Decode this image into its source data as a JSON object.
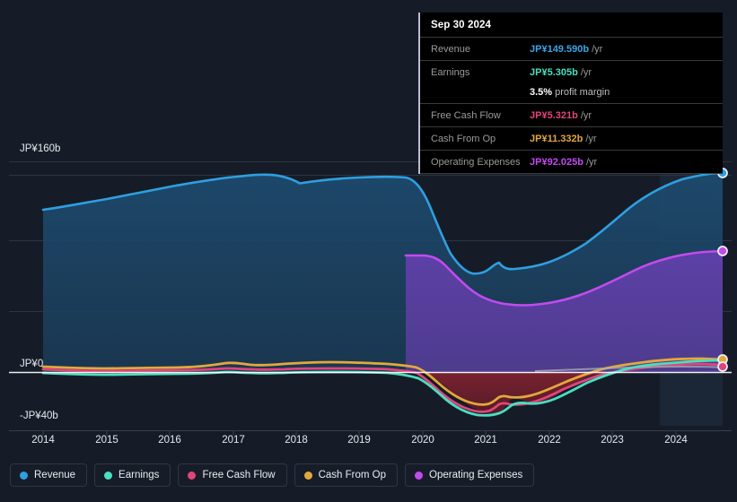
{
  "tooltip": {
    "title": "Sep 30 2024",
    "rows": [
      {
        "label": "Revenue",
        "value": "JP¥149.590b",
        "unit": "/yr",
        "color": "#3aa5e8"
      },
      {
        "label": "Earnings",
        "value": "JP¥5.305b",
        "unit": "/yr",
        "color": "#49dfc0"
      },
      {
        "label": "",
        "value": "3.5%",
        "unit": "profit margin",
        "color": "#ffffff",
        "sub": true
      },
      {
        "label": "Free Cash Flow",
        "value": "JP¥5.321b",
        "unit": "/yr",
        "color": "#e0457b"
      },
      {
        "label": "Cash From Op",
        "value": "JP¥11.332b",
        "unit": "/yr",
        "color": "#e3a83c"
      },
      {
        "label": "Operating Expenses",
        "value": "JP¥92.025b",
        "unit": "/yr",
        "color": "#c34aee"
      }
    ]
  },
  "axes": {
    "y_labels": [
      "JP¥160b",
      "JP¥0",
      "-JP¥40b"
    ],
    "x_labels": [
      "2014",
      "2015",
      "2016",
      "2017",
      "2018",
      "2019",
      "2020",
      "2021",
      "2022",
      "2023",
      "2024"
    ]
  },
  "legend": [
    {
      "label": "Revenue",
      "color": "#2f9fe0"
    },
    {
      "label": "Earnings",
      "color": "#49dfc0"
    },
    {
      "label": "Free Cash Flow",
      "color": "#e0457b"
    },
    {
      "label": "Cash From Op",
      "color": "#e3a83c"
    },
    {
      "label": "Operating Expenses",
      "color": "#c34aee"
    }
  ],
  "chart_data": {
    "type": "area",
    "title": "",
    "xlabel": "",
    "ylabel": "",
    "ylim": [
      -40,
      160
    ],
    "y_ticks": [
      160,
      0,
      -40
    ],
    "grid": true,
    "legend_position": "bottom",
    "currency": "JP¥",
    "units": "billions",
    "x": [
      2013.75,
      2014.0,
      2014.5,
      2015.0,
      2015.5,
      2016.0,
      2016.5,
      2017.0,
      2017.5,
      2018.0,
      2018.5,
      2019.0,
      2019.25,
      2019.5,
      2019.75,
      2020.0,
      2020.25,
      2020.5,
      2020.75,
      2021.0,
      2021.25,
      2021.5,
      2021.75,
      2022.0,
      2022.25,
      2022.5,
      2022.75,
      2023.0,
      2023.5,
      2024.0,
      2024.5,
      2024.75
    ],
    "series": [
      {
        "name": "Revenue",
        "color": "#2f9fe0",
        "values": [
          107,
          108,
          112,
          116,
          121,
          124,
          127,
          130,
          133,
          137,
          139,
          141,
          142,
          143,
          143,
          142,
          130,
          112,
          98,
          92,
          96,
          97,
          98,
          101,
          106,
          113,
          122,
          128,
          134,
          140,
          146,
          149.59
        ]
      },
      {
        "name": "Operating Expenses",
        "color": "#c34aee",
        "values": [
          null,
          null,
          null,
          null,
          null,
          null,
          null,
          null,
          null,
          null,
          null,
          null,
          null,
          null,
          null,
          105,
          104,
          100,
          92,
          86,
          82,
          80,
          79,
          79,
          80,
          82,
          85,
          88,
          90,
          91,
          92,
          92.025
        ]
      },
      {
        "name": "Cash From Op",
        "color": "#e3a83c",
        "values": [
          5,
          5,
          4,
          4,
          4,
          5,
          5,
          6,
          5,
          5,
          6,
          6,
          6,
          6,
          6,
          5,
          0,
          -8,
          -14,
          -17,
          -14,
          -16,
          -10,
          -3,
          2,
          4,
          5,
          6,
          8,
          10,
          11,
          11.332
        ]
      },
      {
        "name": "Free Cash Flow",
        "color": "#e0457b",
        "values": [
          2,
          2,
          1,
          1,
          1,
          2,
          2,
          2,
          2,
          2,
          2,
          2,
          2,
          2,
          2,
          1,
          -3,
          -11,
          -17,
          -20,
          -17,
          -19,
          -13,
          -6,
          0,
          2,
          3,
          4,
          5,
          5,
          5,
          5.321
        ]
      },
      {
        "name": "Earnings",
        "color": "#49dfc0",
        "values": [
          -2,
          -2,
          -2,
          -2,
          -2,
          -2,
          -2,
          -2,
          -2,
          -2,
          -2,
          -2,
          -2,
          -2,
          -2,
          -4,
          -9,
          -17,
          -22,
          -23,
          -23,
          -20,
          -16,
          -12,
          -6,
          -2,
          0,
          1,
          2,
          3,
          4,
          5.305
        ]
      }
    ],
    "highlight_band": {
      "from_x": 2023.65,
      "to_x": 2024.75,
      "note": "lighter shaded recent period"
    },
    "endpoint_markers": [
      "Revenue",
      "Operating Expenses",
      "Cash From Op",
      "Free Cash Flow"
    ]
  }
}
